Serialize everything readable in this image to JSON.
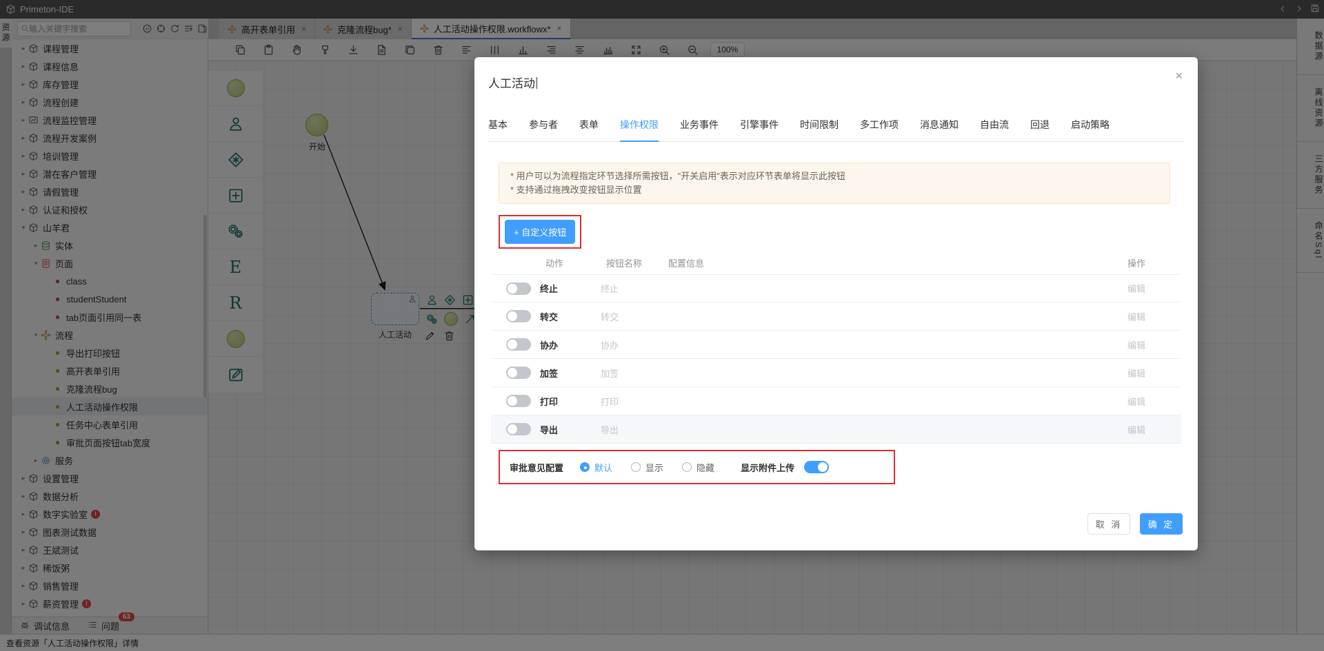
{
  "app": {
    "title": "Primeton-IDE"
  },
  "left_rail": {
    "label": "资源"
  },
  "right_rail": {
    "items": [
      "数据源",
      "离线资源",
      "三方服务",
      "命名Sql"
    ]
  },
  "search": {
    "placeholder": "输入关键字搜索",
    "icons": [
      "ai-circle",
      "target",
      "refresh",
      "collapse-list",
      "file-switch"
    ]
  },
  "editor_tabs": [
    {
      "label": "高开表单引用",
      "active": false
    },
    {
      "label": "克隆流程bug*",
      "active": false
    },
    {
      "label": "人工活动操作权限.workflowx*",
      "active": true
    }
  ],
  "toolbar": {
    "icons": [
      "copy",
      "clipboard",
      "hand",
      "brush",
      "download",
      "file",
      "file-copy",
      "trash",
      "align-left",
      "columns",
      "chart-columns",
      "align-right",
      "align-center",
      "chart-bars",
      "fit-screen",
      "zoom-in",
      "zoom-out"
    ],
    "zoom_level": "100%"
  },
  "sidebar": {
    "items": [
      {
        "depth": 0,
        "icon": "cube",
        "label": "课程管理",
        "caret": "right"
      },
      {
        "depth": 0,
        "icon": "cube",
        "label": "课程信息",
        "caret": "right"
      },
      {
        "depth": 0,
        "icon": "cube",
        "label": "库存管理",
        "caret": "right"
      },
      {
        "depth": 0,
        "icon": "cube",
        "label": "流程创建",
        "caret": "right"
      },
      {
        "depth": 0,
        "icon": "board",
        "label": "流程监控管理",
        "caret": "right"
      },
      {
        "depth": 0,
        "icon": "cube",
        "label": "流程开发案例",
        "caret": "right"
      },
      {
        "depth": 0,
        "icon": "cube",
        "label": "培训管理",
        "caret": "right"
      },
      {
        "depth": 0,
        "icon": "cube",
        "label": "潜在客户管理",
        "caret": "right"
      },
      {
        "depth": 0,
        "icon": "cube",
        "label": "请假管理",
        "caret": "right"
      },
      {
        "depth": 0,
        "icon": "cube",
        "label": "认证和授权",
        "caret": "right"
      },
      {
        "depth": 0,
        "icon": "cube",
        "label": "山羊君",
        "caret": "down"
      },
      {
        "depth": 1,
        "icon": "db",
        "label": "实体",
        "caret": "right"
      },
      {
        "depth": 1,
        "icon": "page",
        "label": "页面",
        "caret": "down"
      },
      {
        "depth": 2,
        "icon": "dot-red",
        "label": "class"
      },
      {
        "depth": 2,
        "icon": "dot-red",
        "label": "studentStudent"
      },
      {
        "depth": 2,
        "icon": "dot-red",
        "label": "tab页面引用同一表"
      },
      {
        "depth": 1,
        "icon": "flow",
        "label": "流程",
        "caret": "down"
      },
      {
        "depth": 2,
        "icon": "dot-orange",
        "label": "导出打印按钮"
      },
      {
        "depth": 2,
        "icon": "dot-orange",
        "label": "高开表单引用"
      },
      {
        "depth": 2,
        "icon": "dot-orange",
        "label": "克隆流程bug"
      },
      {
        "depth": 2,
        "icon": "dot-orange",
        "label": "人工活动操作权限",
        "selected": true
      },
      {
        "depth": 2,
        "icon": "dot-orange",
        "label": "任务中心表单引用"
      },
      {
        "depth": 2,
        "icon": "dot-orange",
        "label": "审批页面按钮tab宽度"
      },
      {
        "depth": 1,
        "icon": "gear-blue",
        "label": "服务",
        "caret": "right"
      },
      {
        "depth": 0,
        "icon": "cube",
        "label": "设置管理",
        "caret": "right"
      },
      {
        "depth": 0,
        "icon": "cube",
        "label": "数据分析",
        "caret": "right"
      },
      {
        "depth": 0,
        "icon": "cube",
        "label": "数字实验室",
        "caret": "right",
        "badge": "!"
      },
      {
        "depth": 0,
        "icon": "cube",
        "label": "图表测试数据",
        "caret": "right"
      },
      {
        "depth": 0,
        "icon": "cube",
        "label": "王斌测试",
        "caret": "right"
      },
      {
        "depth": 0,
        "icon": "cube",
        "label": "稀饭粥",
        "caret": "right"
      },
      {
        "depth": 0,
        "icon": "cube",
        "label": "销售管理",
        "caret": "right"
      },
      {
        "depth": 0,
        "icon": "cube",
        "label": "薪资管理",
        "caret": "right",
        "badge": "!"
      }
    ]
  },
  "bottom_bar": {
    "debug": "调试信息",
    "problems": "问题",
    "problems_count": "63"
  },
  "status_bar": {
    "text": "查看资源「人工活动操作权限」详情"
  },
  "canvas": {
    "start_label": "开始",
    "activity_label": "人工活动",
    "palette_icons": [
      "start-circle",
      "person",
      "gateway-diamond",
      "subprocess-square",
      "auto-gears",
      "letter-e",
      "letter-r",
      "end-circle",
      "edit-note"
    ],
    "hover_icons_row1": [
      "person",
      "gateway-diamond",
      "subprocess-square"
    ],
    "hover_icons_row2": [
      "auto-gears",
      "end-circle",
      "connector-arrow"
    ],
    "hover_icons_row3": [
      "pencil",
      "trash"
    ]
  },
  "modal": {
    "title": "人工活动",
    "tabs": [
      "基本",
      "参与者",
      "表单",
      "操作权限",
      "业务事件",
      "引擎事件",
      "时间限制",
      "多工作项",
      "消息通知",
      "自由流",
      "回退",
      "启动策略"
    ],
    "active_tab": "操作权限",
    "notice": [
      "* 用户可以为流程指定环节选择所需按钮，\"开关启用\"表示对应环节表单将显示此按钮",
      "* 支持通过拖拽改变按钮显示位置"
    ],
    "custom_button": "+ 自定义按钮",
    "table": {
      "headers": [
        "动作",
        "按钮名称",
        "配置信息",
        "操作"
      ],
      "rows": [
        {
          "action": "终止",
          "name": "终止",
          "enabled": false,
          "op": "编辑",
          "highlight": false
        },
        {
          "action": "转交",
          "name": "转交",
          "enabled": false,
          "op": "编辑",
          "highlight": false
        },
        {
          "action": "协办",
          "name": "协办",
          "enabled": false,
          "op": "编辑",
          "highlight": false
        },
        {
          "action": "加签",
          "name": "加签",
          "enabled": false,
          "op": "编辑",
          "highlight": false
        },
        {
          "action": "打印",
          "name": "打印",
          "enabled": false,
          "op": "编辑",
          "highlight": false
        },
        {
          "action": "导出",
          "name": "导出",
          "enabled": false,
          "op": "编辑",
          "highlight": true
        }
      ]
    },
    "config": {
      "label": "审批意见配置",
      "options": [
        "默认",
        "显示",
        "隐藏"
      ],
      "selected": "默认",
      "attachment_label": "显示附件上传",
      "attachment_on": true
    },
    "footer": {
      "cancel": "取 消",
      "ok": "确 定"
    },
    "accent_color": "#409eff",
    "annotation_color": "#e12b2b"
  }
}
